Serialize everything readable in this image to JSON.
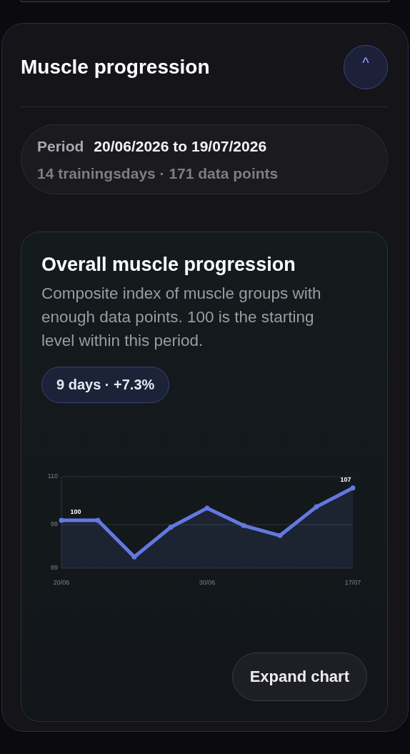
{
  "section": {
    "title": "Muscle progression",
    "toggle": "^",
    "expanded": true
  },
  "period": {
    "label": "Period",
    "range": "20/06/2026 to 19/07/2026",
    "summary": "14 trainingsdays · 171 data points"
  },
  "overall": {
    "title": "Overall muscle progression",
    "description": "Composite index of muscle groups with enough data points. 100 is the starting level within this period.",
    "badge": "9 days · +7.3%",
    "chart_data": {
      "type": "area",
      "categories": [
        "20/06",
        null,
        null,
        null,
        "30/06",
        null,
        null,
        null,
        "17/07"
      ],
      "series": [
        {
          "color": "#6478e0",
          "values": [
            100.0,
            100.0,
            91.6,
            98.4,
            102.8,
            98.8,
            96.5,
            103.1,
            107.4
          ]
        }
      ],
      "ylim": [
        89,
        110
      ],
      "yticks": [
        89,
        99,
        110
      ],
      "value_labels": [
        "100",
        null,
        null,
        null,
        null,
        null,
        null,
        null,
        "107"
      ]
    },
    "button": "Expand chart"
  }
}
